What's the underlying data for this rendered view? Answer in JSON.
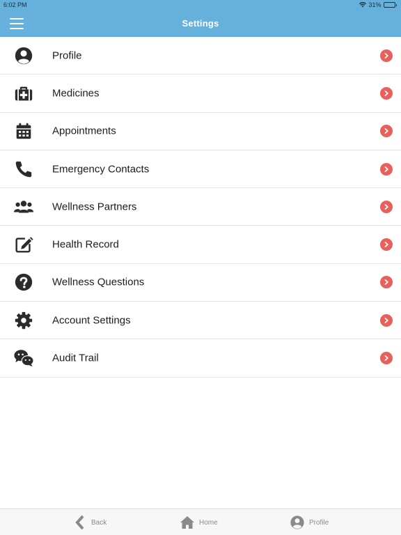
{
  "status_bar": {
    "time": "6:02 PM",
    "battery_percent": "31%",
    "battery_level": 0.31
  },
  "header": {
    "title": "Settings",
    "menu_icon": "hamburger-menu-icon"
  },
  "colors": {
    "header": "#66b0dc",
    "chevron": "#e8605c",
    "icon": "#2b2b2b",
    "tab_inactive": "#8a8a8a"
  },
  "settings_items": [
    {
      "label": "Profile",
      "icon": "user-circle-icon"
    },
    {
      "label": "Medicines",
      "icon": "medical-kit-icon"
    },
    {
      "label": "Appointments",
      "icon": "calendar-icon"
    },
    {
      "label": "Emergency Contacts",
      "icon": "phone-icon"
    },
    {
      "label": "Wellness Partners",
      "icon": "users-group-icon"
    },
    {
      "label": "Health Record",
      "icon": "edit-note-icon"
    },
    {
      "label": "Wellness Questions",
      "icon": "question-circle-icon"
    },
    {
      "label": "Account Settings",
      "icon": "gear-icon"
    },
    {
      "label": "Audit Trail",
      "icon": "chat-bubbles-icon"
    }
  ],
  "tab_bar": {
    "back": {
      "label": "Back",
      "icon": "back-chevron-icon"
    },
    "home": {
      "label": "Home",
      "icon": "home-icon"
    },
    "profile": {
      "label": "Profile",
      "icon": "user-circle-icon"
    }
  }
}
